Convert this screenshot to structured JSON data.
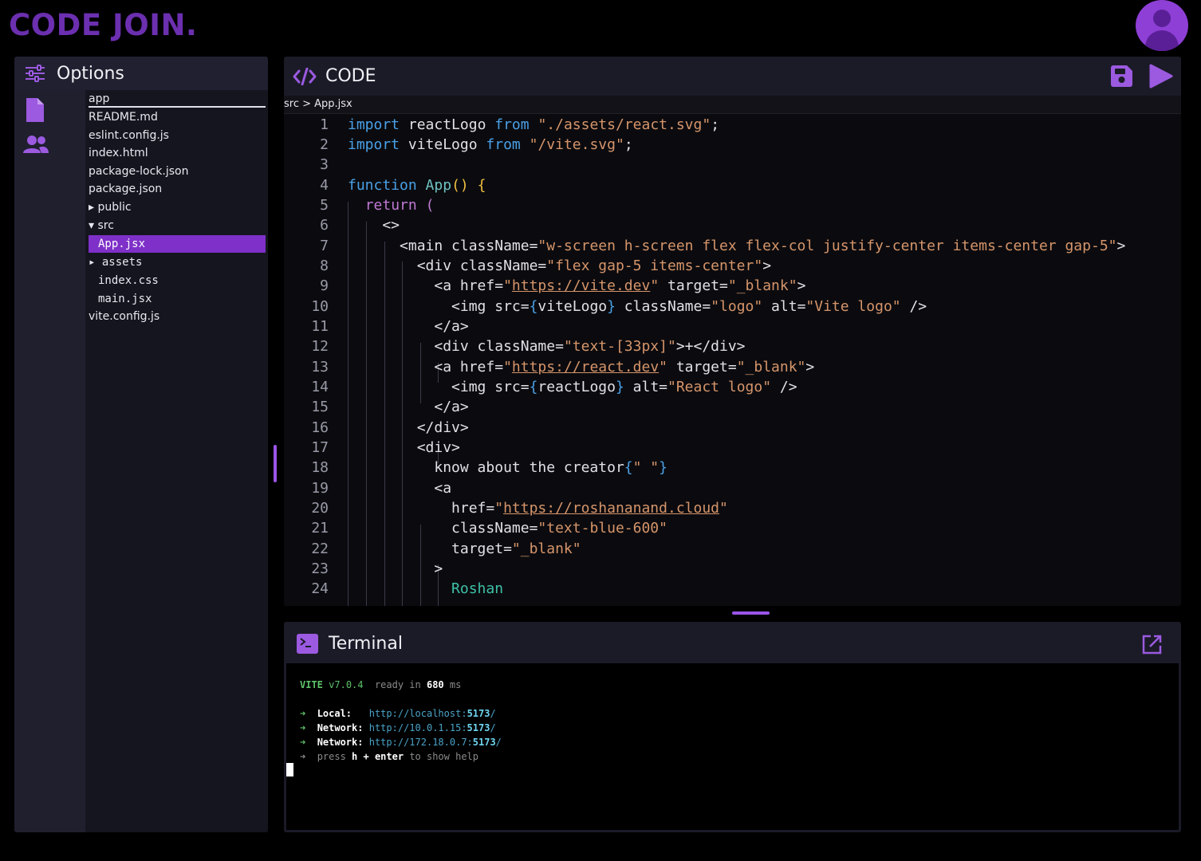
{
  "brand": "CODE JOIN.",
  "colors": {
    "accent": "#7e30c8",
    "brand": "#6b2fb0"
  },
  "sidebar": {
    "title": "Options",
    "icons": [
      "sliders-icon",
      "file-icon",
      "users-icon"
    ],
    "files": [
      {
        "label": "app",
        "type": "folder-root"
      },
      {
        "label": "README.md"
      },
      {
        "label": "eslint.config.js"
      },
      {
        "label": "index.html"
      },
      {
        "label": "package-lock.json"
      },
      {
        "label": "package.json"
      },
      {
        "label": "▸ public"
      },
      {
        "label": "▾ src"
      },
      {
        "label": "App.jsx",
        "selected": true
      },
      {
        "label": "▸ assets"
      },
      {
        "label": "index.css"
      },
      {
        "label": "main.jsx"
      },
      {
        "label": "vite.config.js"
      }
    ]
  },
  "editor": {
    "title": "CODE",
    "breadcrumb": "src > App.jsx",
    "line_numbers": [
      "1",
      "2",
      "3",
      "4",
      "5",
      "6",
      "7",
      "8",
      "9",
      "10",
      "11",
      "12",
      "13",
      "14",
      "15",
      "16",
      "17",
      "18",
      "19",
      "20",
      "21",
      "22",
      "23",
      "24"
    ]
  },
  "terminal": {
    "title": "Terminal",
    "vite": "VITE",
    "version": "v7.0.4",
    "ready": "ready in",
    "ms_value": "680",
    "ms_unit": "ms",
    "arrow": "➜",
    "local_label": "Local:",
    "local_url": "http://localhost:",
    "network_label": "Network:",
    "network_url1": "http://10.0.1.15:",
    "network_url2": "http://172.18.0.7:",
    "port": "5173",
    "slash": "/",
    "press": "press",
    "h_enter": "h + enter",
    "to_show_help": "to show help"
  }
}
